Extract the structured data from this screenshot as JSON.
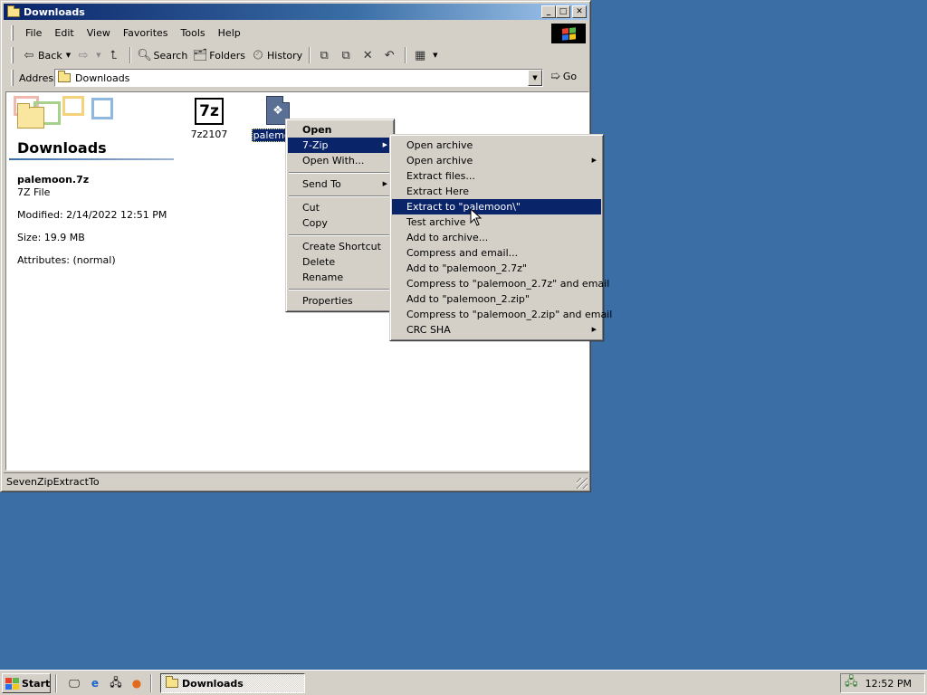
{
  "window": {
    "title": "Downloads",
    "title_icon": "folder-icon"
  },
  "menubar": [
    "File",
    "Edit",
    "View",
    "Favorites",
    "Tools",
    "Help"
  ],
  "toolbar": {
    "back": "Back",
    "search": "Search",
    "folders": "Folders",
    "history": "History"
  },
  "address": {
    "label": "Address",
    "value": "Downloads",
    "go": "Go"
  },
  "details": {
    "folder_name": "Downloads",
    "file_name": "palemoon.7z",
    "file_type": "7Z File",
    "modified": "Modified: 2/14/2022 12:51 PM",
    "size": "Size: 19.9 MB",
    "attributes": "Attributes: (normal)"
  },
  "files": [
    {
      "name": "7z2107",
      "icon": "7z-installer-icon",
      "selected": false
    },
    {
      "name": "palemoon",
      "icon": "palemoon-archive-icon",
      "selected": true
    }
  ],
  "context_menu": {
    "items": [
      {
        "label": "Open",
        "bold": true
      },
      {
        "label": "7-Zip",
        "submenu": true,
        "highlighted": true
      },
      {
        "label": "Open With..."
      },
      {
        "separator": true
      },
      {
        "label": "Send To",
        "submenu": true
      },
      {
        "separator": true
      },
      {
        "label": "Cut"
      },
      {
        "label": "Copy"
      },
      {
        "separator": true
      },
      {
        "label": "Create Shortcut"
      },
      {
        "label": "Delete"
      },
      {
        "label": "Rename"
      },
      {
        "separator": true
      },
      {
        "label": "Properties"
      }
    ]
  },
  "sevenzip_menu": {
    "items": [
      {
        "label": "Open archive"
      },
      {
        "label": "Open archive",
        "submenu": true
      },
      {
        "label": "Extract files..."
      },
      {
        "label": "Extract Here"
      },
      {
        "label": "Extract to \"palemoon\\\"",
        "highlighted": true
      },
      {
        "label": "Test archive"
      },
      {
        "label": "Add to archive..."
      },
      {
        "label": "Compress and email..."
      },
      {
        "label": "Add to \"palemoon_2.7z\""
      },
      {
        "label": "Compress to \"palemoon_2.7z\" and email"
      },
      {
        "label": "Add to \"palemoon_2.zip\""
      },
      {
        "label": "Compress to \"palemoon_2.zip\" and email"
      },
      {
        "label": "CRC SHA",
        "submenu": true
      }
    ]
  },
  "statusbar": {
    "text": "SevenZipExtractTo"
  },
  "taskbar": {
    "start": "Start",
    "task": "Downloads",
    "clock": "12:52 PM"
  },
  "colors": {
    "desktop": "#3a6ea5",
    "highlight": "#0a246a",
    "face": "#d4d0c8"
  }
}
